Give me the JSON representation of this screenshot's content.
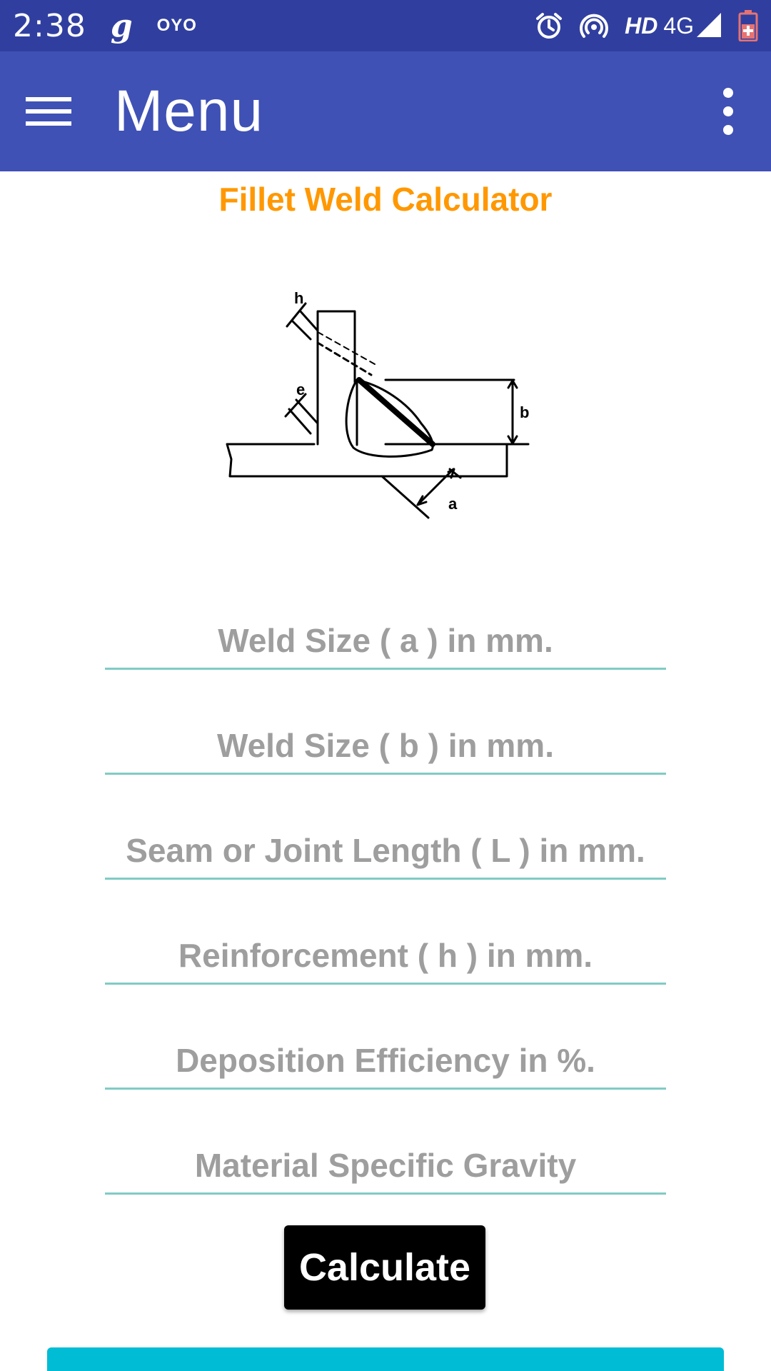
{
  "status_bar": {
    "time": "2:38",
    "app_icon_g": "g",
    "app_icon_oyo": "OYO",
    "hd_label": "HD",
    "network_label": "4G",
    "icons": [
      "alarm-icon",
      "hotspot-icon",
      "signal-icon",
      "battery-icon"
    ]
  },
  "app_bar": {
    "title": "Menu",
    "left_icon": "hamburger-icon",
    "right_icon": "more-vert-icon",
    "color": "#3f51b5",
    "status_color": "#303f9f"
  },
  "calculator": {
    "title": "Fillet Weld Calculator",
    "title_color": "#ff9800",
    "diagram_labels": {
      "h": "h",
      "e": "e",
      "b": "b",
      "a": "a"
    },
    "fields": [
      {
        "placeholder": "Weld Size ( a ) in mm.",
        "value": ""
      },
      {
        "placeholder": "Weld Size ( b ) in mm.",
        "value": ""
      },
      {
        "placeholder": "Seam or Joint Length ( L ) in mm.",
        "value": ""
      },
      {
        "placeholder": "Reinforcement ( h ) in mm.",
        "value": ""
      },
      {
        "placeholder": "Deposition Efficiency in %.",
        "value": ""
      },
      {
        "placeholder": "Material Specific Gravity",
        "value": ""
      }
    ],
    "calculate_label": "Calculate",
    "accent_line_color": "#80cbc4",
    "bottom_bar_color": "#00bcd4"
  }
}
